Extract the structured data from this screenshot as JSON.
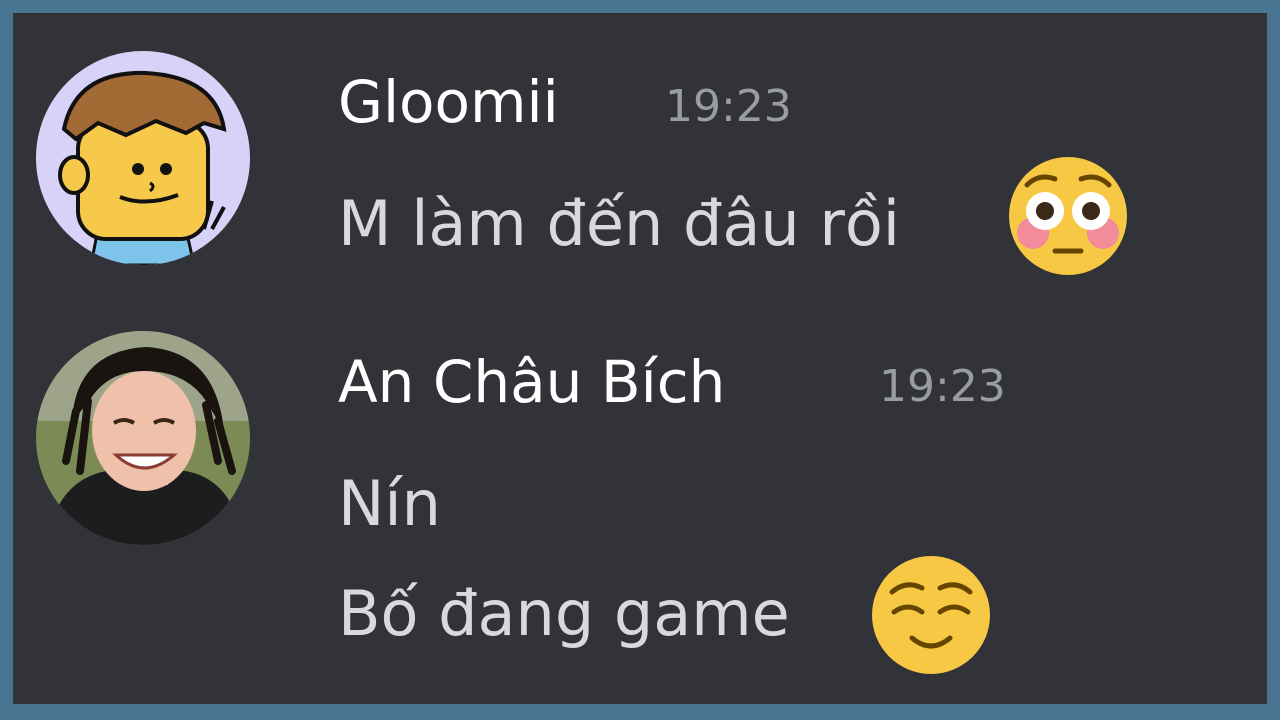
{
  "messages": [
    {
      "author": "Gloomii",
      "timestamp": "19:23",
      "avatar_icon": "cartoon-boy-avatar",
      "lines": [
        {
          "text": "M làm đến đâu rồi",
          "emoji": "flushed-face-emoji"
        }
      ]
    },
    {
      "author": "An Châu Bích",
      "timestamp": "19:23",
      "avatar_icon": "smiling-man-avatar",
      "lines": [
        {
          "text": "Nín"
        },
        {
          "text": "Bố đang game",
          "emoji": "relieved-face-emoji"
        }
      ]
    }
  ],
  "colors": {
    "background": "#313338",
    "border": "#4a7590",
    "username": "#ffffff",
    "timestamp": "#9a9ca3",
    "message": "#d8d9dc"
  }
}
